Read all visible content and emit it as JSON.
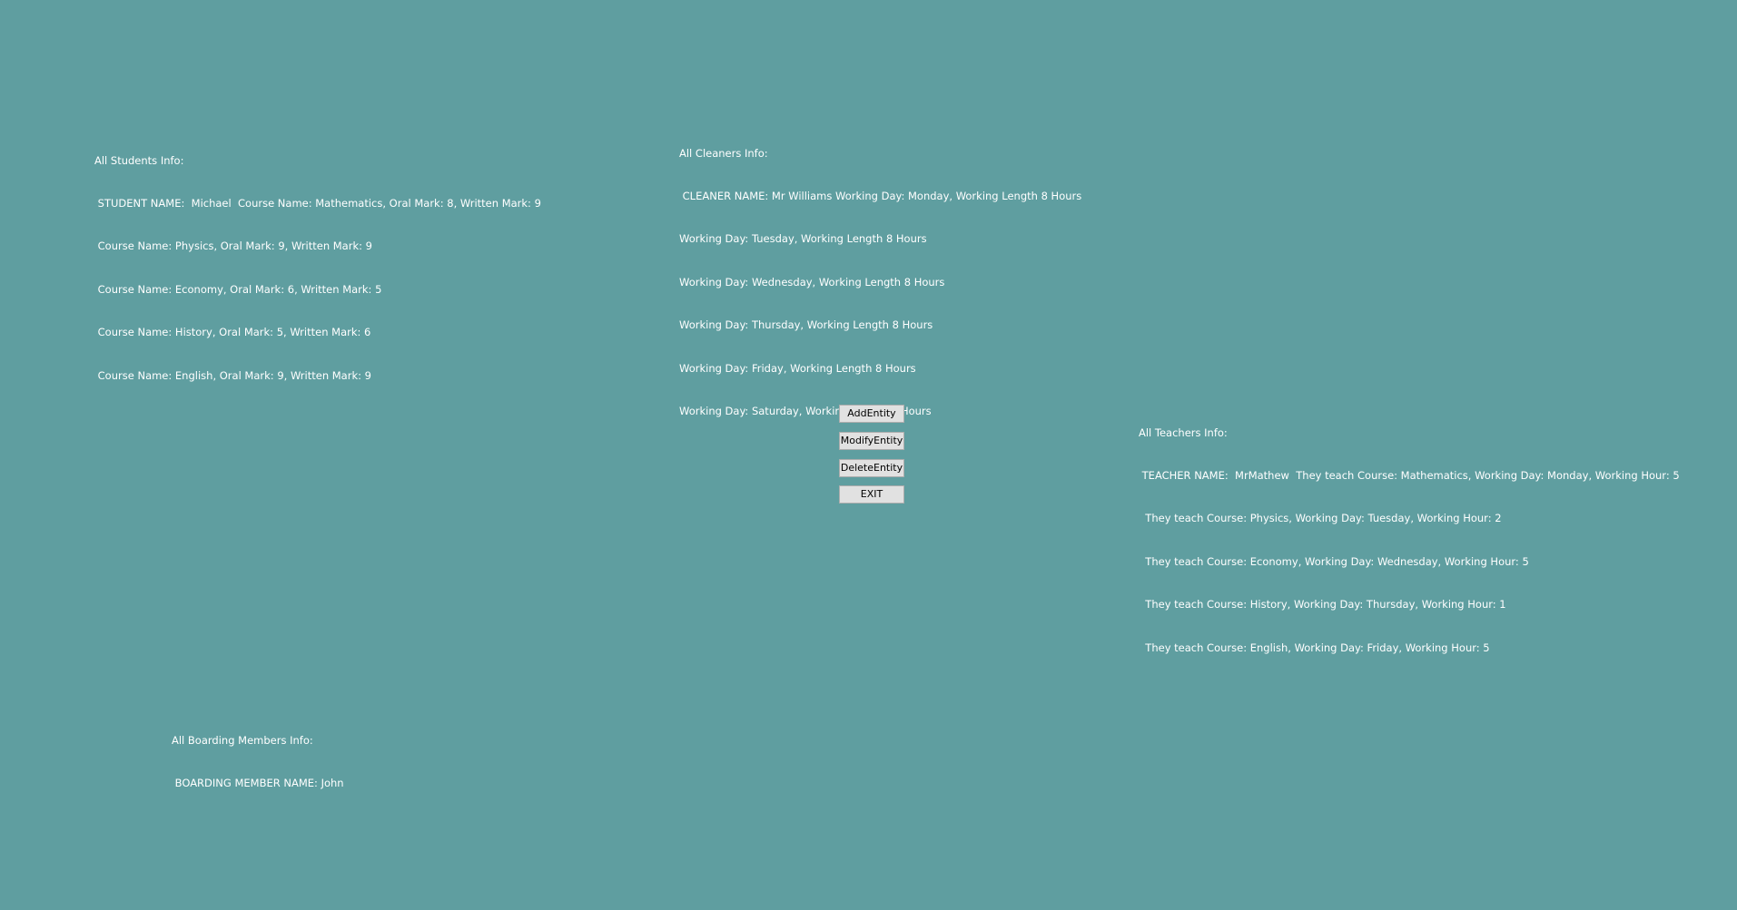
{
  "students": {
    "header": "All Students Info:",
    "lines": [
      " STUDENT NAME:  Michael  Course Name: Mathematics, Oral Mark: 8, Written Mark: 9",
      " Course Name: Physics, Oral Mark: 9, Written Mark: 9",
      " Course Name: Economy, Oral Mark: 6, Written Mark: 5",
      " Course Name: History, Oral Mark: 5, Written Mark: 6",
      " Course Name: English, Oral Mark: 9, Written Mark: 9"
    ]
  },
  "cleaners": {
    "header": "All Cleaners Info:",
    "lines": [
      " CLEANER NAME: Mr Williams Working Day: Monday, Working Length 8 Hours",
      "Working Day: Tuesday, Working Length 8 Hours",
      "Working Day: Wednesday, Working Length 8 Hours",
      "Working Day: Thursday, Working Length 8 Hours",
      "Working Day: Friday, Working Length 8 Hours",
      "Working Day: Saturday, Working Length 4 Hours"
    ]
  },
  "teachers": {
    "header": "All Teachers Info:",
    "lines": [
      " TEACHER NAME:  MrMathew  They teach Course: Mathematics, Working Day: Monday, Working Hour: 5",
      "  They teach Course: Physics, Working Day: Tuesday, Working Hour: 2",
      "  They teach Course: Economy, Working Day: Wednesday, Working Hour: 5",
      "  They teach Course: History, Working Day: Thursday, Working Hour: 1",
      "  They teach Course: English, Working Day: Friday, Working Hour: 5"
    ]
  },
  "boarding": {
    "header": "All Boarding Members Info:",
    "lines": [
      " BOARDING MEMBER NAME: John"
    ]
  },
  "buttons": {
    "add": "AddEntity",
    "modify": "ModifyEntity",
    "delete": "DeleteEntity",
    "exit": "EXIT"
  },
  "colors": {
    "background": "#5f9ea0",
    "text": "#ffffff",
    "button_face": "#e1e1e1",
    "button_border": "#adadad"
  }
}
